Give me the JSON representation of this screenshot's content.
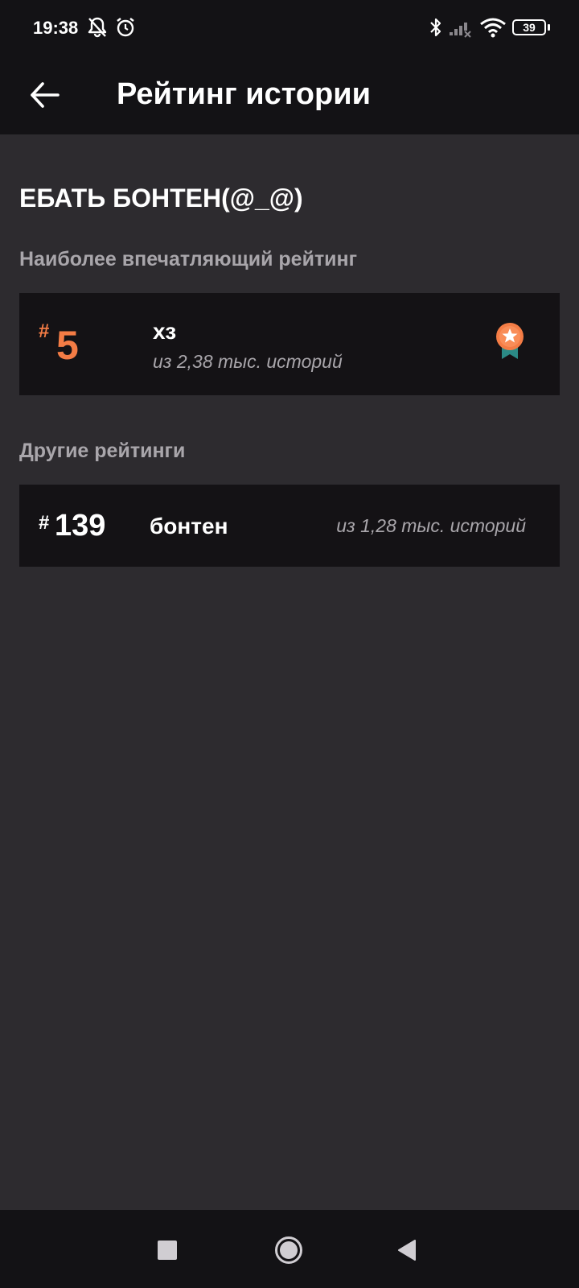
{
  "status_bar": {
    "time": "19:38",
    "battery": "39",
    "icons": [
      "bell-off-icon",
      "alarm-icon",
      "bluetooth-icon",
      "signal-icon",
      "wifi-icon",
      "battery-icon"
    ]
  },
  "header": {
    "title": "Рейтинг истории",
    "back_icon": "arrow-left-icon"
  },
  "story": {
    "title": "ЕБАТЬ БОНТЕН(@_@)"
  },
  "top_ranking": {
    "section_title": "Наиболее впечатляющий рейтинг",
    "hash": "#",
    "rank": "5",
    "tag": "хз",
    "of_text": "из 2,38 тыс. историй",
    "icon": "medal-icon"
  },
  "other_rankings": {
    "section_title": "Другие рейтинги",
    "items": [
      {
        "hash": "#",
        "rank": "139",
        "tag": "бонтен",
        "of_text": "из 1,28 тыс. историй"
      }
    ]
  },
  "nav_bar": {
    "buttons": [
      "recents-square-icon",
      "home-circle-icon",
      "back-triangle-icon"
    ]
  },
  "colors": {
    "accent": "#f47c45",
    "background": "#2d2b2f",
    "bars": "#131215",
    "card": "#141215",
    "secondary_text": "#a9a6ab"
  }
}
